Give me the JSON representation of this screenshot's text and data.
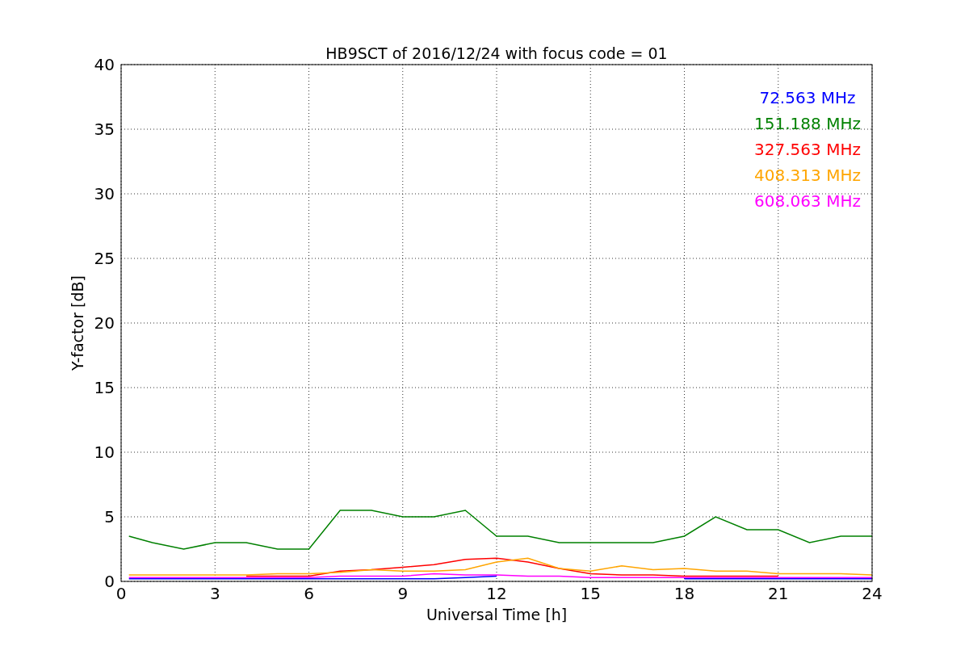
{
  "chart_data": {
    "type": "line",
    "title": "HB9SCT of 2016/12/24 with focus code = 01",
    "xlabel": "Universal Time [h]",
    "ylabel": "Y-factor [dB]",
    "x": [
      0.25,
      1,
      2,
      3,
      4,
      5,
      6,
      7,
      8,
      9,
      10,
      11,
      12,
      13,
      14,
      15,
      16,
      17,
      18,
      19,
      20,
      21,
      22,
      23,
      24
    ],
    "series": [
      {
        "name": "72.563 MHz",
        "color": "#0000ff",
        "values": [
          0.2,
          0.2,
          0.2,
          0.2,
          0.2,
          0.2,
          0.2,
          0.2,
          0.2,
          0.2,
          0.2,
          0.3,
          0.4,
          null,
          null,
          null,
          null,
          null,
          0.2,
          0.2,
          0.2,
          0.2,
          0.2,
          0.2,
          0.2
        ]
      },
      {
        "name": "151.188 MHz",
        "color": "#008000",
        "values": [
          3.5,
          3,
          2.5,
          3,
          3,
          2.5,
          2.5,
          5.5,
          5.5,
          5,
          5,
          5.5,
          3.5,
          3.5,
          3,
          3,
          3,
          3,
          3.5,
          5,
          4,
          4,
          3,
          3.5,
          3.5
        ]
      },
      {
        "name": "327.563 MHz",
        "color": "#ff0000",
        "values": [
          null,
          null,
          null,
          null,
          0.4,
          0.4,
          0.4,
          0.8,
          0.9,
          1.1,
          1.3,
          1.7,
          1.8,
          1.5,
          1,
          0.6,
          0.5,
          0.5,
          0.4,
          0.4,
          0.4,
          0.4,
          null,
          null,
          null
        ]
      },
      {
        "name": "408.313 MHz",
        "color": "#ffa500",
        "values": [
          0.5,
          0.5,
          0.5,
          0.5,
          0.5,
          0.6,
          0.6,
          0.7,
          0.9,
          0.8,
          0.8,
          0.9,
          1.5,
          1.8,
          1,
          0.8,
          1.2,
          0.9,
          1,
          0.8,
          0.8,
          0.6,
          0.6,
          0.6,
          0.5
        ]
      },
      {
        "name": "608.063 MHz",
        "color": "#ff00ff",
        "values": [
          0.3,
          0.3,
          0.3,
          0.3,
          0.3,
          0.3,
          0.3,
          0.4,
          0.4,
          0.4,
          0.6,
          0.5,
          0.5,
          0.4,
          0.4,
          0.3,
          0.3,
          0.3,
          0.3,
          0.3,
          0.3,
          0.3,
          0.3,
          0.3,
          0.3
        ]
      }
    ],
    "grid": true,
    "xlim": [
      0,
      24
    ],
    "ylim": [
      0,
      40
    ],
    "xticks": [
      0,
      3,
      6,
      9,
      12,
      15,
      18,
      21,
      24
    ],
    "yticks": [
      0,
      5,
      10,
      15,
      20,
      25,
      30,
      35,
      40
    ]
  }
}
